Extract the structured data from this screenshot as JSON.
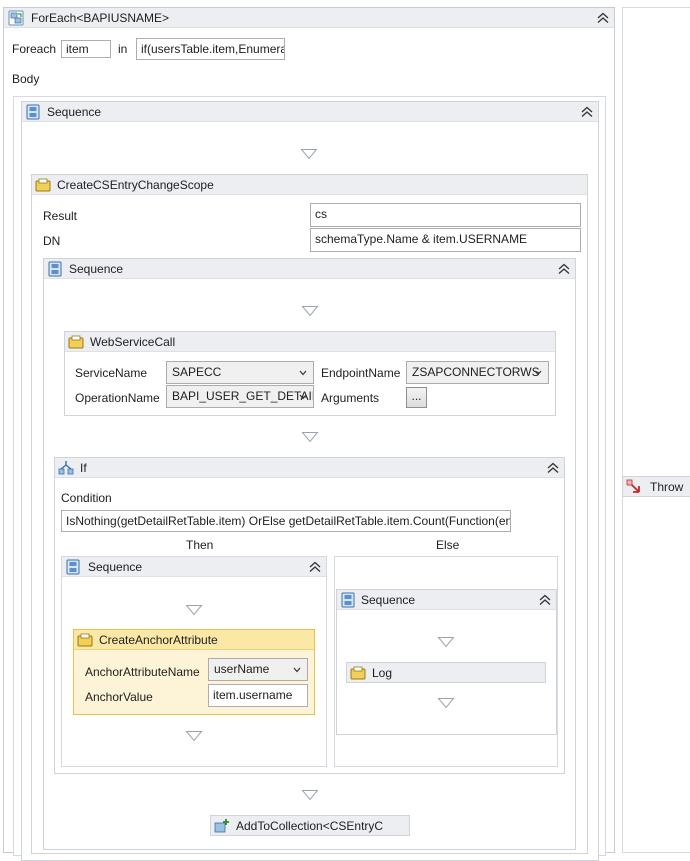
{
  "foreach": {
    "title": "ForEach<BAPIUSNAME>",
    "foreach_label": "Foreach",
    "item_value": "item",
    "in_label": "in",
    "in_value": "if(usersTable.item,Enumerable",
    "body_label": "Body"
  },
  "seq_outer": {
    "title": "Sequence"
  },
  "create_cs": {
    "title": "CreateCSEntryChangeScope",
    "result_label": "Result",
    "result_value": "cs",
    "dn_label": "DN",
    "dn_value": "schemaType.Name & item.USERNAME"
  },
  "seq_inner": {
    "title": "Sequence"
  },
  "webservice": {
    "title": "WebServiceCall",
    "service_label": "ServiceName",
    "service_value": "SAPECC",
    "endpoint_label": "EndpointName",
    "endpoint_value": "ZSAPCONNECTORWS",
    "operation_label": "OperationName",
    "operation_value": "BAPI_USER_GET_DETAIL",
    "arguments_label": "Arguments",
    "arguments_button": "..."
  },
  "if_act": {
    "title": "If",
    "condition_label": "Condition",
    "condition_value": "IsNothing(getDetailRetTable.item) OrElse getDetailRetTable.item.Count(Function(entry",
    "then_label": "Then",
    "else_label": "Else"
  },
  "seq_then": {
    "title": "Sequence"
  },
  "anchor": {
    "title": "CreateAnchorAttribute",
    "name_label": "AnchorAttributeName",
    "name_value": "userName",
    "value_label": "AnchorValue",
    "value_value": "item.username"
  },
  "seq_else": {
    "title": "Sequence"
  },
  "log": {
    "title": "Log"
  },
  "add_collection": {
    "title": "AddToCollection<CSEntryC"
  },
  "throw": {
    "title": "Throw"
  },
  "colors": {
    "header_bg": "#eceef2",
    "border": "#cfd4db",
    "selected_bg": "#fdf4d7",
    "selected_border": "#e7c24a"
  },
  "icons": [
    "foreach-icon",
    "sequence-icon",
    "scope-icon",
    "if-icon",
    "throw-icon",
    "add-to-collection-icon",
    "collapse-icon",
    "drop-arrow-icon"
  ]
}
